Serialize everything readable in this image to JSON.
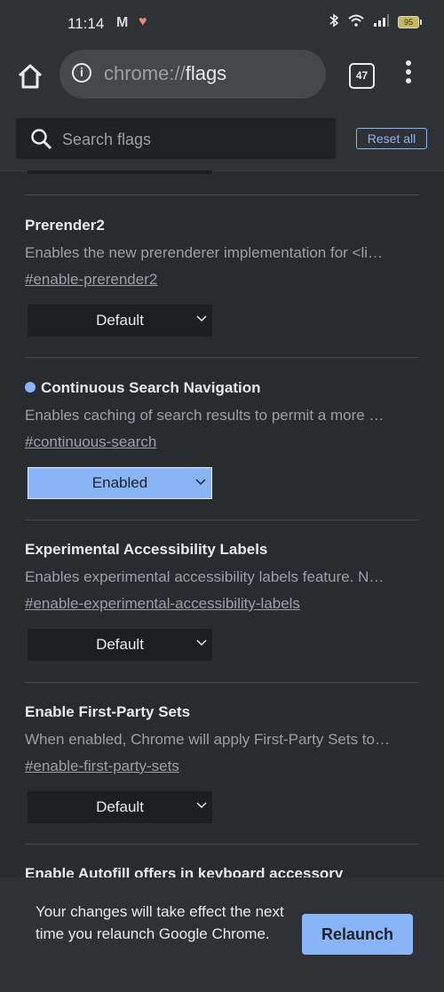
{
  "status_bar": {
    "time": "11:14",
    "gmail_icon": "gmail-icon",
    "health_icon": "heart-icon",
    "bluetooth_icon": "bluetooth-icon",
    "wifi_icon": "wifi-icon",
    "signal_icon": "signal-icon",
    "battery_level": "95"
  },
  "toolbar": {
    "url_scheme": "chrome://",
    "url_host": "flags",
    "tab_count": "47",
    "home_icon": "home-icon",
    "info_icon": "info-icon",
    "menu_icon": "more-vert-icon"
  },
  "search": {
    "placeholder": "Search flags",
    "value": "",
    "reset_label": "Reset all"
  },
  "flags": [
    {
      "title": "Prerender2",
      "modified": false,
      "description": "Enables the new prerenderer implementation for <li…",
      "link": "#enable-prerender2",
      "value": "Default"
    },
    {
      "title": "Continuous Search Navigation",
      "modified": true,
      "description": "Enables caching of search results to permit a more …",
      "link": "#continuous-search",
      "value": "Enabled"
    },
    {
      "title": "Experimental Accessibility Labels",
      "modified": false,
      "description": "Enables experimental accessibility labels feature. N…",
      "link": "#enable-experimental-accessibility-labels",
      "value": "Default"
    },
    {
      "title": "Enable First-Party Sets",
      "modified": false,
      "description": "When enabled, Chrome will apply First-Party Sets to…",
      "link": "#enable-first-party-sets",
      "value": "Default"
    }
  ],
  "partial_flag_title": "Enable Autofill offers in keyboard accessory",
  "snackbar": {
    "message": "Your changes will take effect the next time you relaunch Google Chrome.",
    "button_label": "Relaunch"
  },
  "colors": {
    "accent": "#8ab4f8",
    "background": "#2a2b2f",
    "toolbar": "#303135"
  }
}
